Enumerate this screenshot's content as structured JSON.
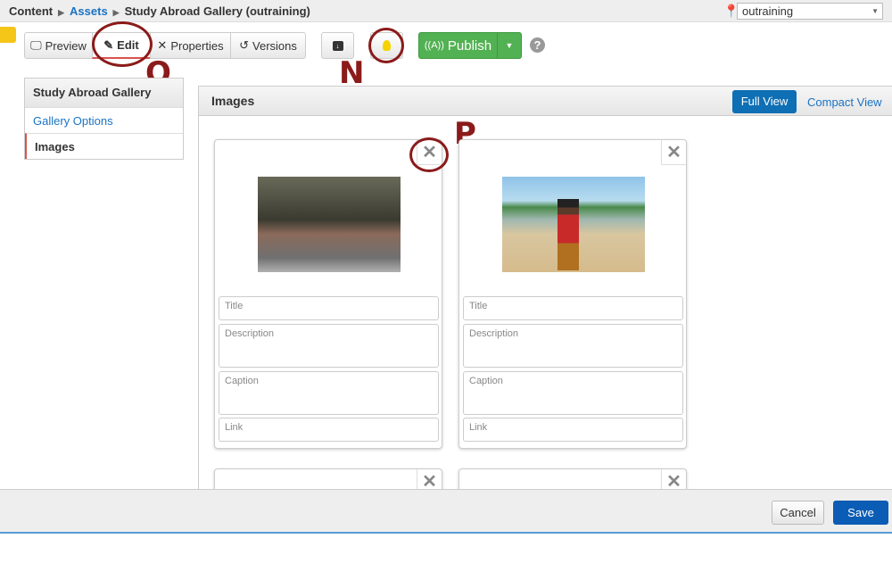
{
  "breadcrumb": {
    "items": [
      "Content",
      "Assets",
      "Study Abroad Gallery (outraining)"
    ]
  },
  "site_selector": {
    "value": "outraining"
  },
  "toolbar": {
    "preview": "Preview",
    "edit": "Edit",
    "properties": "Properties",
    "versions": "Versions",
    "publish": "Publish"
  },
  "annotations": {
    "o": "O",
    "n": "N",
    "p": "P"
  },
  "sidebar": {
    "title": "Study Abroad Gallery",
    "items": [
      {
        "label": "Gallery Options"
      },
      {
        "label": "Images"
      }
    ]
  },
  "main": {
    "title": "Images",
    "full_view": "Full View",
    "compact_view": "Compact View"
  },
  "cards": [
    {
      "fields": {
        "title": "Title",
        "description": "Description",
        "caption": "Caption",
        "link": "Link"
      }
    },
    {
      "fields": {
        "title": "Title",
        "description": "Description",
        "caption": "Caption",
        "link": "Link"
      }
    }
  ],
  "footer": {
    "cancel": "Cancel",
    "save": "Save"
  }
}
